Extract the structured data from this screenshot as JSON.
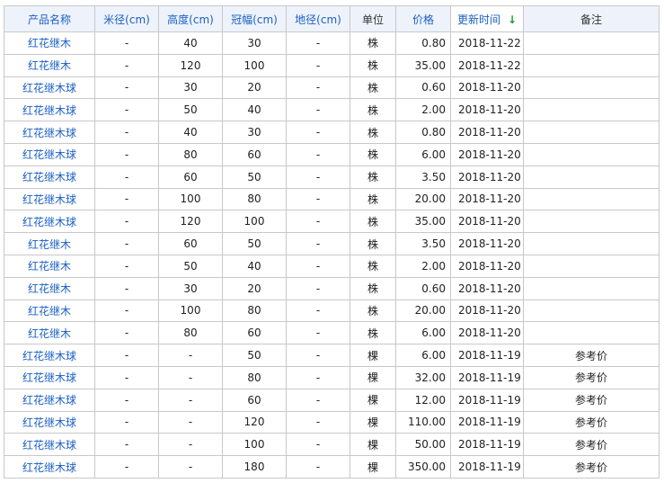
{
  "table": {
    "headers": {
      "name": "产品名称",
      "diameter": "米径(cm)",
      "height": "高度(cm)",
      "crown": "冠幅(cm)",
      "ground_diameter": "地径(cm)",
      "unit": "单位",
      "price": "价格",
      "updated": "更新时间",
      "note": "备注"
    },
    "sort_indicator": "↓",
    "rows": [
      {
        "name": "红花继木",
        "diameter": "-",
        "height": "40",
        "crown": "30",
        "ground_diameter": "-",
        "unit": "株",
        "price": "0.80",
        "updated": "2018-11-22",
        "note": ""
      },
      {
        "name": "红花继木",
        "diameter": "-",
        "height": "120",
        "crown": "100",
        "ground_diameter": "-",
        "unit": "株",
        "price": "35.00",
        "updated": "2018-11-22",
        "note": ""
      },
      {
        "name": "红花继木球",
        "diameter": "-",
        "height": "30",
        "crown": "20",
        "ground_diameter": "-",
        "unit": "株",
        "price": "0.60",
        "updated": "2018-11-20",
        "note": ""
      },
      {
        "name": "红花继木球",
        "diameter": "-",
        "height": "50",
        "crown": "40",
        "ground_diameter": "-",
        "unit": "株",
        "price": "2.00",
        "updated": "2018-11-20",
        "note": ""
      },
      {
        "name": "红花继木球",
        "diameter": "-",
        "height": "40",
        "crown": "30",
        "ground_diameter": "-",
        "unit": "株",
        "price": "0.80",
        "updated": "2018-11-20",
        "note": ""
      },
      {
        "name": "红花继木球",
        "diameter": "-",
        "height": "80",
        "crown": "60",
        "ground_diameter": "-",
        "unit": "株",
        "price": "6.00",
        "updated": "2018-11-20",
        "note": ""
      },
      {
        "name": "红花继木球",
        "diameter": "-",
        "height": "60",
        "crown": "50",
        "ground_diameter": "-",
        "unit": "株",
        "price": "3.50",
        "updated": "2018-11-20",
        "note": ""
      },
      {
        "name": "红花继木球",
        "diameter": "-",
        "height": "100",
        "crown": "80",
        "ground_diameter": "-",
        "unit": "株",
        "price": "20.00",
        "updated": "2018-11-20",
        "note": ""
      },
      {
        "name": "红花继木球",
        "diameter": "-",
        "height": "120",
        "crown": "100",
        "ground_diameter": "-",
        "unit": "株",
        "price": "35.00",
        "updated": "2018-11-20",
        "note": ""
      },
      {
        "name": "红花继木",
        "diameter": "-",
        "height": "60",
        "crown": "50",
        "ground_diameter": "-",
        "unit": "株",
        "price": "3.50",
        "updated": "2018-11-20",
        "note": ""
      },
      {
        "name": "红花继木",
        "diameter": "-",
        "height": "50",
        "crown": "40",
        "ground_diameter": "-",
        "unit": "株",
        "price": "2.00",
        "updated": "2018-11-20",
        "note": ""
      },
      {
        "name": "红花继木",
        "diameter": "-",
        "height": "30",
        "crown": "20",
        "ground_diameter": "-",
        "unit": "株",
        "price": "0.60",
        "updated": "2018-11-20",
        "note": ""
      },
      {
        "name": "红花继木",
        "diameter": "-",
        "height": "100",
        "crown": "80",
        "ground_diameter": "-",
        "unit": "株",
        "price": "20.00",
        "updated": "2018-11-20",
        "note": ""
      },
      {
        "name": "红花继木",
        "diameter": "-",
        "height": "80",
        "crown": "60",
        "ground_diameter": "-",
        "unit": "株",
        "price": "6.00",
        "updated": "2018-11-20",
        "note": ""
      },
      {
        "name": "红花继木球",
        "diameter": "-",
        "height": "-",
        "crown": "50",
        "ground_diameter": "-",
        "unit": "棵",
        "price": "6.00",
        "updated": "2018-11-19",
        "note": "参考价"
      },
      {
        "name": "红花继木球",
        "diameter": "-",
        "height": "-",
        "crown": "80",
        "ground_diameter": "-",
        "unit": "棵",
        "price": "32.00",
        "updated": "2018-11-19",
        "note": "参考价"
      },
      {
        "name": "红花继木球",
        "diameter": "-",
        "height": "-",
        "crown": "60",
        "ground_diameter": "-",
        "unit": "棵",
        "price": "12.00",
        "updated": "2018-11-19",
        "note": "参考价"
      },
      {
        "name": "红花继木球",
        "diameter": "-",
        "height": "-",
        "crown": "120",
        "ground_diameter": "-",
        "unit": "棵",
        "price": "110.00",
        "updated": "2018-11-19",
        "note": "参考价"
      },
      {
        "name": "红花继木球",
        "diameter": "-",
        "height": "-",
        "crown": "100",
        "ground_diameter": "-",
        "unit": "棵",
        "price": "50.00",
        "updated": "2018-11-19",
        "note": "参考价"
      },
      {
        "name": "红花继木球",
        "diameter": "-",
        "height": "-",
        "crown": "180",
        "ground_diameter": "-",
        "unit": "棵",
        "price": "350.00",
        "updated": "2018-11-19",
        "note": "参考价"
      }
    ]
  }
}
